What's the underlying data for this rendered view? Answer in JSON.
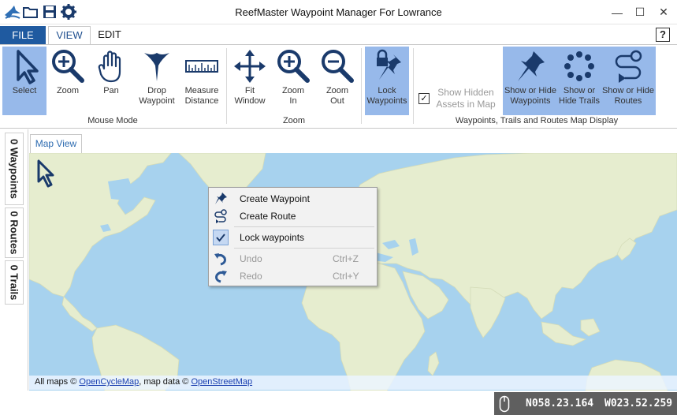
{
  "window": {
    "title": "ReefMaster Waypoint Manager For Lowrance",
    "minimize": "—",
    "maximize": "☐",
    "close": "✕"
  },
  "quick_access": [
    "logo-icon",
    "open-folder-icon",
    "save-icon",
    "settings-icon"
  ],
  "ribbon_tabs": {
    "file": "FILE",
    "view": "VIEW",
    "edit": "EDIT",
    "help": "?"
  },
  "ribbon": {
    "mouse_mode": {
      "group_label": "Mouse Mode",
      "buttons": [
        {
          "label": "Select",
          "icon": "select-arrow-icon",
          "selected": true
        },
        {
          "label": "Zoom",
          "icon": "zoom-icon",
          "selected": false
        },
        {
          "label": "Pan",
          "icon": "hand-icon",
          "selected": false
        },
        {
          "label": "Drop\nWaypoint",
          "icon": "drop-waypoint-icon",
          "selected": false
        },
        {
          "label": "Measure\nDistance",
          "icon": "ruler-icon",
          "selected": false
        }
      ]
    },
    "zoom": {
      "group_label": "Zoom",
      "buttons": [
        {
          "label": "Fit\nWindow",
          "icon": "fit-window-icon"
        },
        {
          "label": "Zoom\nIn",
          "icon": "zoom-in-icon"
        },
        {
          "label": "Zoom\nOut",
          "icon": "zoom-out-icon"
        }
      ]
    },
    "lock": {
      "label": "Lock\nWaypoints",
      "icon": "lock-pin-icon",
      "selected": true
    },
    "display": {
      "group_label": "Waypoints, Trails and Routes Map Display",
      "show_hidden_label": "Show Hidden\nAssets in Map",
      "show_hidden_checked": true,
      "buttons": [
        {
          "label": "Show or Hide\nWaypoints",
          "icon": "pin-icon"
        },
        {
          "label": "Show or\nHide Trails",
          "icon": "trail-dots-icon"
        },
        {
          "label": "Show or Hide\nRoutes",
          "icon": "route-icon"
        }
      ]
    }
  },
  "side_tabs": [
    "0 Waypoints",
    "0 Routes",
    "0 Trails"
  ],
  "doc_tab": "Map View",
  "attribution": {
    "prefix": "All maps © ",
    "link1": "OpenCycleMap",
    "middle": ", map data © ",
    "link2": "OpenStreetMap"
  },
  "context_menu": {
    "items": [
      {
        "label": "Create Waypoint",
        "icon": "pin-icon",
        "shortcut": "",
        "enabled": true
      },
      {
        "label": "Create Route",
        "icon": "route-icon",
        "shortcut": "",
        "enabled": true
      },
      {
        "label": "Lock waypoints",
        "icon": "checkmark-icon",
        "shortcut": "",
        "enabled": true,
        "checked": true
      },
      {
        "label": "Undo",
        "icon": "undo-icon",
        "shortcut": "Ctrl+Z",
        "enabled": false
      },
      {
        "label": "Redo",
        "icon": "redo-icon",
        "shortcut": "Ctrl+Y",
        "enabled": false
      }
    ]
  },
  "status": {
    "lat": "N058.23.164",
    "lon": "W023.52.259"
  },
  "colors": {
    "accent": "#1f5aa0",
    "selected": "#97b9ea",
    "ocean": "#a7d2ee",
    "land": "#e6edcf",
    "icon": "#1a3a6b"
  }
}
